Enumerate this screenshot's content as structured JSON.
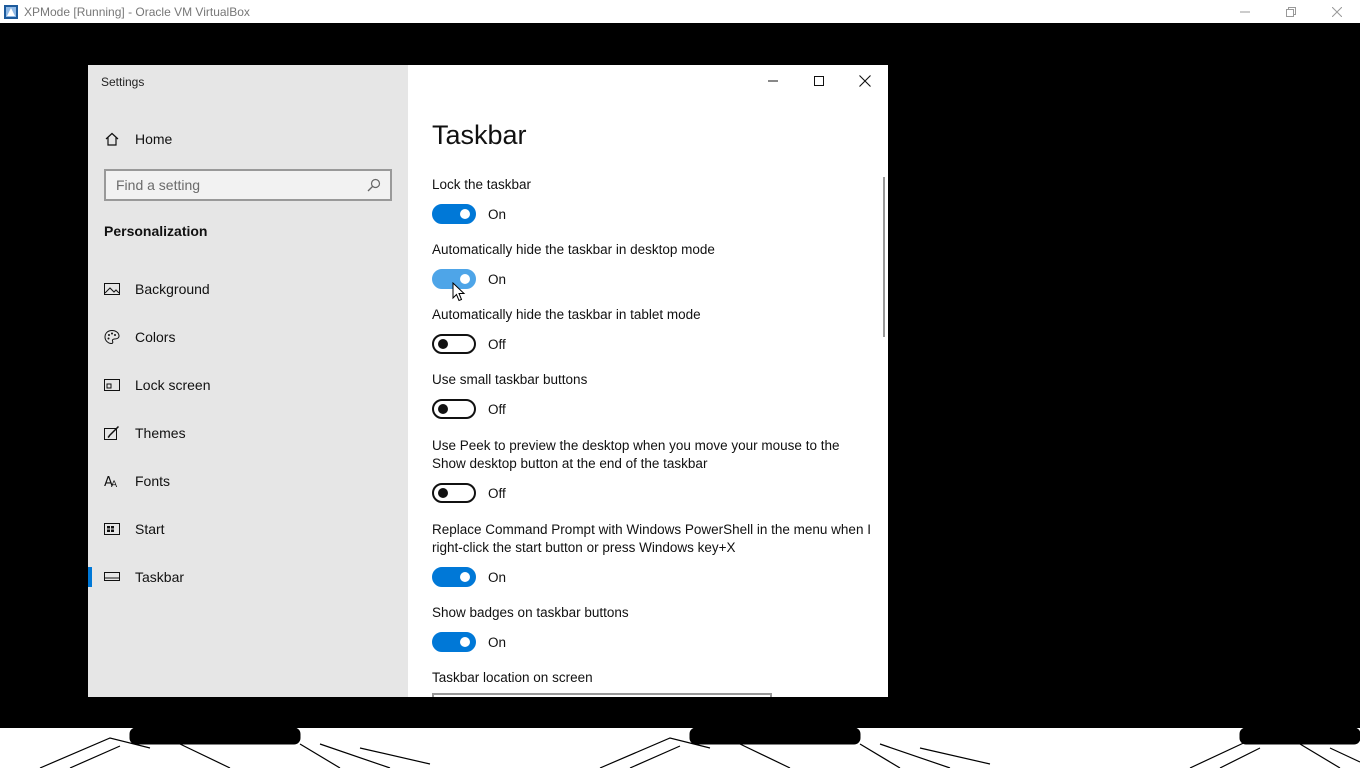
{
  "host": {
    "title": "XPMode [Running] - Oracle VM VirtualBox",
    "icons": [
      "virtualbox-app-icon",
      "minimize-icon",
      "restore-icon",
      "close-icon"
    ]
  },
  "settings": {
    "window_title": "Settings",
    "home_label": "Home",
    "search": {
      "placeholder": "Find a setting"
    },
    "section": "Personalization",
    "nav": [
      {
        "label": "Background",
        "icon": "picture-icon"
      },
      {
        "label": "Colors",
        "icon": "palette-icon"
      },
      {
        "label": "Lock screen",
        "icon": "lock-screen-icon"
      },
      {
        "label": "Themes",
        "icon": "brush-icon"
      },
      {
        "label": "Fonts",
        "icon": "font-icon"
      },
      {
        "label": "Start",
        "icon": "start-icon"
      },
      {
        "label": "Taskbar",
        "icon": "taskbar-icon",
        "selected": true
      }
    ],
    "page_title": "Taskbar",
    "options": [
      {
        "label": "Lock the taskbar",
        "state": "On",
        "on": true
      },
      {
        "label": "Automatically hide the taskbar in desktop mode",
        "state": "On",
        "on": true
      },
      {
        "label": "Automatically hide the taskbar in tablet mode",
        "state": "Off",
        "on": false
      },
      {
        "label": "Use small taskbar buttons",
        "state": "Off",
        "on": false
      },
      {
        "label": "Use Peek to preview the desktop when you move your mouse to the Show desktop button at the end of the taskbar",
        "state": "Off",
        "on": false
      },
      {
        "label": "Replace Command Prompt with Windows PowerShell in the menu when I right-click the start button or press Windows key+X",
        "state": "On",
        "on": true
      },
      {
        "label": "Show badges on taskbar buttons",
        "state": "On",
        "on": true
      }
    ],
    "location_label": "Taskbar location on screen",
    "accent_color": "#0078d7"
  }
}
